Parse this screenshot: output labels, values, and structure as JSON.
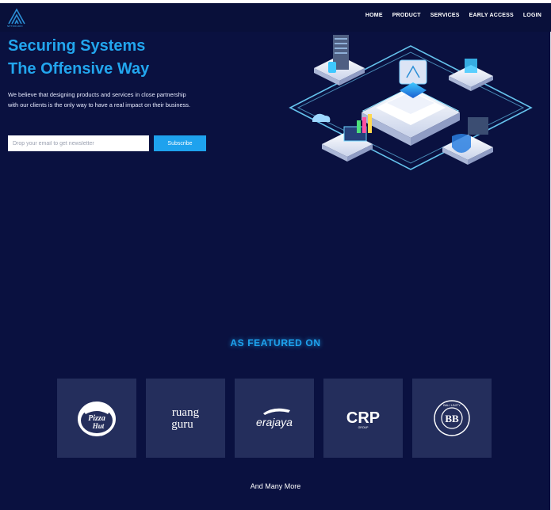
{
  "nav": {
    "logo_text": "NETROGRID",
    "items": [
      "HOME",
      "PRODUCT",
      "SERVICES",
      "EARLY ACCESS",
      "LOGIN"
    ]
  },
  "hero": {
    "title_line1": "Securing Systems",
    "title_line2": "The Offensive Way",
    "description": "We believe that designing products and services in close partnership with our clients is the only way to have a real impact on their business.",
    "email_placeholder": "Drop your email to get newsletter",
    "subscribe_label": "Subscribe"
  },
  "featured": {
    "heading": "AS FEATURED ON",
    "partners": [
      {
        "name": "Pizza Hut",
        "text1": "Pizza",
        "text2": "Hut"
      },
      {
        "name": "ruangguru",
        "text1": "ruang",
        "text2": "guru"
      },
      {
        "name": "erajaya",
        "text1": "erajaya"
      },
      {
        "name": "CRP Group",
        "text1": "CRP",
        "text2": "GROUP"
      },
      {
        "name": "Bali Unity",
        "text1": "BALI UNITY",
        "text2": "BB"
      }
    ],
    "more_label": "And Many More"
  },
  "colors": {
    "background": "#0a1140",
    "accent": "#1ea2ee",
    "card": "#242e5c"
  }
}
